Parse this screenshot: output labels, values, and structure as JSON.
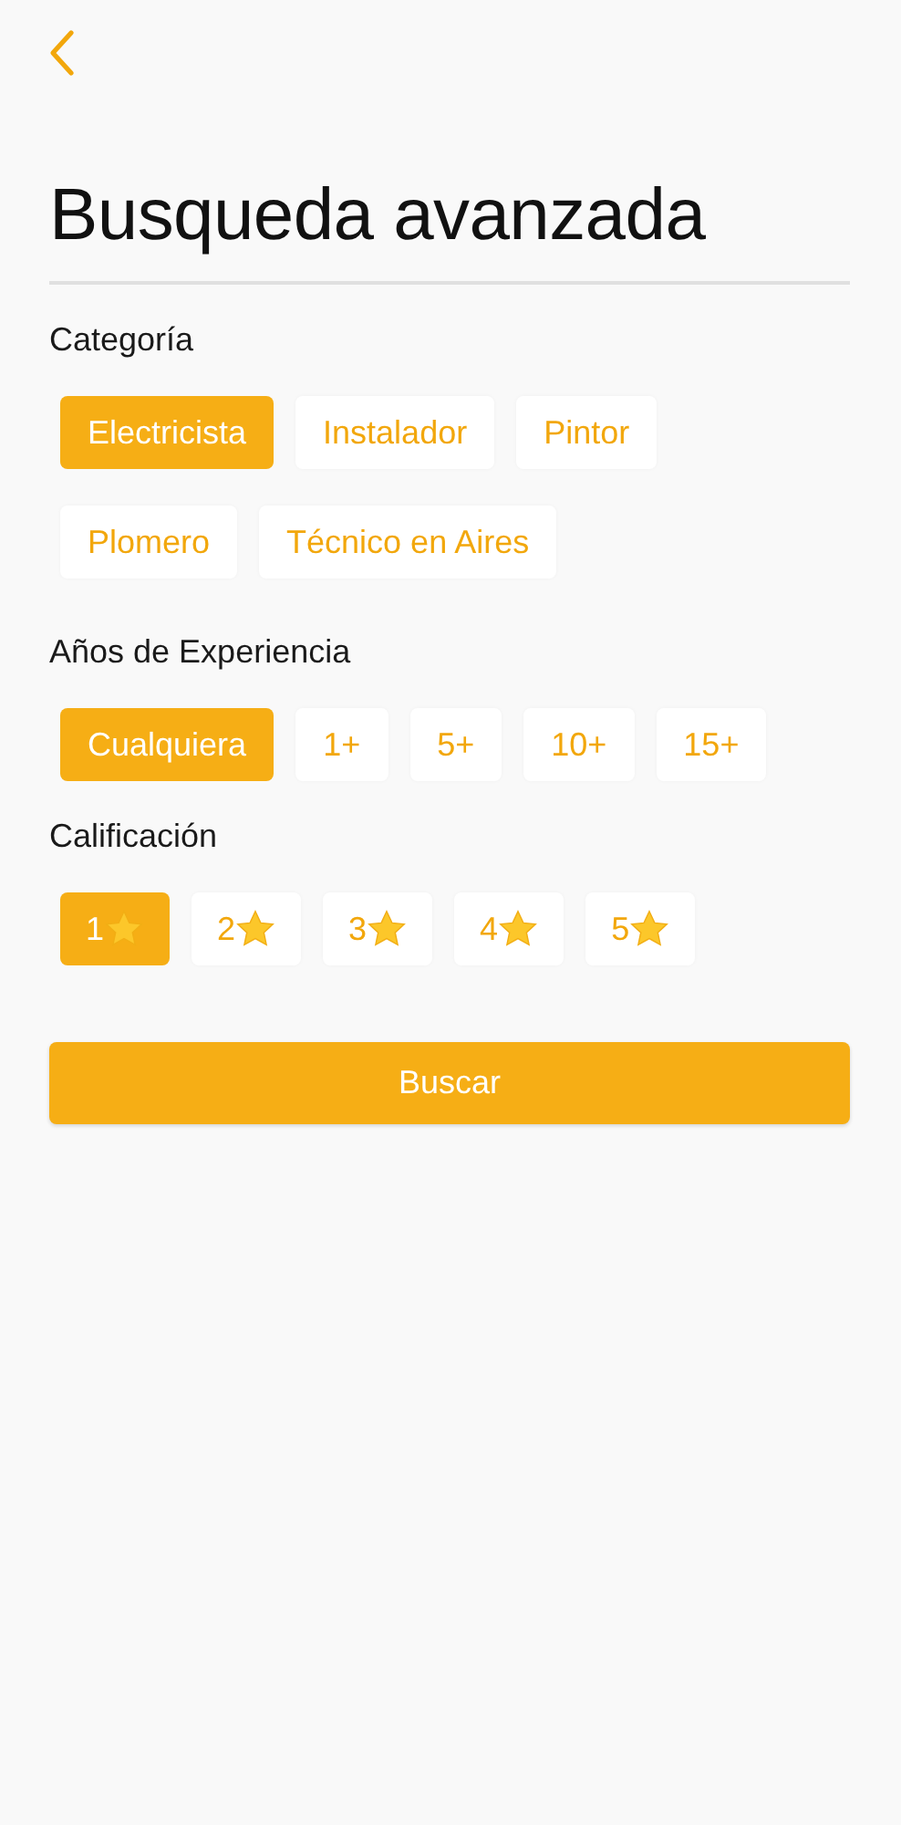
{
  "title": "Busqueda avanzada",
  "sections": [
    {
      "label": "Categoría",
      "kind": "text",
      "options": [
        {
          "label": "Electricista",
          "selected": true
        },
        {
          "label": "Instalador",
          "selected": false
        },
        {
          "label": "Pintor",
          "selected": false
        },
        {
          "label": "Plomero",
          "selected": false
        },
        {
          "label": "Técnico en Aires",
          "selected": false
        }
      ]
    },
    {
      "label": "Años de Experiencia",
      "kind": "text",
      "options": [
        {
          "label": "Cualquiera",
          "selected": true
        },
        {
          "label": "1+",
          "selected": false
        },
        {
          "label": "5+",
          "selected": false
        },
        {
          "label": "10+",
          "selected": false
        },
        {
          "label": "15+",
          "selected": false
        }
      ]
    },
    {
      "label": "Calificación",
      "kind": "rating",
      "options": [
        {
          "label": "1",
          "selected": true
        },
        {
          "label": "2",
          "selected": false
        },
        {
          "label": "3",
          "selected": false
        },
        {
          "label": "4",
          "selected": false
        },
        {
          "label": "5",
          "selected": false
        }
      ]
    }
  ],
  "submit": "Buscar"
}
